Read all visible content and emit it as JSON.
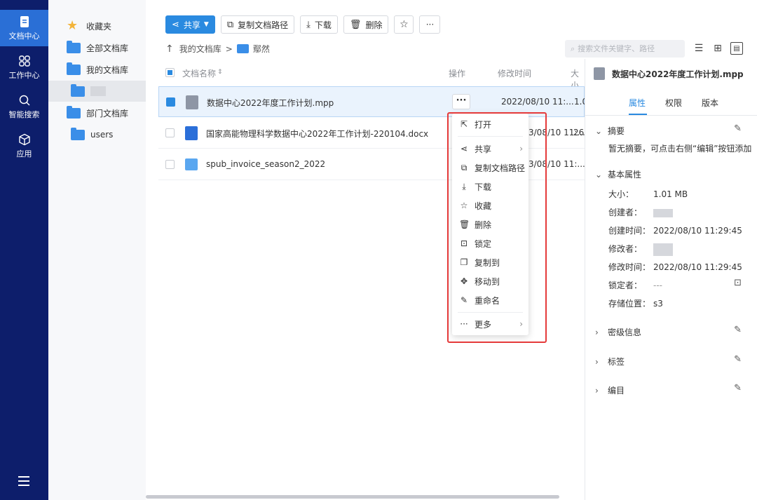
{
  "nav": {
    "items": [
      {
        "label": "文档中心",
        "icon": "document-icon",
        "active": true
      },
      {
        "label": "工作中心",
        "icon": "grid-icon",
        "active": false
      },
      {
        "label": "智能搜索",
        "icon": "search-icon",
        "active": false
      },
      {
        "label": "应用",
        "icon": "cube-icon",
        "active": false
      }
    ],
    "menu_icon": "hamburger-icon"
  },
  "libraries": [
    {
      "label": "收藏夹",
      "icon": "star-icon"
    },
    {
      "label": "全部文档库",
      "icon": "folder-icon"
    },
    {
      "label": "我的文档库",
      "icon": "user-folder-icon"
    },
    {
      "label": "",
      "icon": "shared-folder-icon",
      "selected": true
    },
    {
      "label": "部门文档库",
      "icon": "dept-folder-icon"
    },
    {
      "label": "users",
      "icon": "user-folder-icon"
    }
  ],
  "toolbar": {
    "share": "共享",
    "copy_path": "复制文档路径",
    "download": "下载",
    "delete": "删除",
    "more": "···"
  },
  "breadcrumb": {
    "root": "我的文档库",
    "current": "鄢然"
  },
  "search": {
    "placeholder": "搜索文件关键字、路径"
  },
  "table": {
    "headers": {
      "name": "文档名称",
      "ops": "操作",
      "modified": "修改时间",
      "size": "大小"
    },
    "rows": [
      {
        "name": "数据中心2022年度工作计划.mpp",
        "modified": "2022/08/10 11:...",
        "size": "1.0",
        "type": "mpp",
        "selected": true
      },
      {
        "name": "国家高能物理科学数据中心2022年工作计划-220104.docx",
        "modified": "3/08/10 11:...",
        "size": "26.",
        "type": "docx",
        "selected": false
      },
      {
        "name": "spub_invoice_season2_2022",
        "modified": "3/08/10 11:...",
        "size": "",
        "type": "folder",
        "selected": false
      }
    ]
  },
  "context_menu": {
    "items": [
      {
        "label": "打开",
        "icon": "open-external-icon"
      },
      {
        "label": "共享",
        "icon": "share-icon",
        "submenu": true
      },
      {
        "label": "复制文档路径",
        "icon": "copy-icon"
      },
      {
        "label": "下载",
        "icon": "download-icon"
      },
      {
        "label": "收藏",
        "icon": "star-icon"
      },
      {
        "label": "删除",
        "icon": "trash-icon"
      },
      {
        "label": "锁定",
        "icon": "lock-icon"
      },
      {
        "label": "复制到",
        "icon": "copy-to-icon"
      },
      {
        "label": "移动到",
        "icon": "move-icon"
      },
      {
        "label": "重命名",
        "icon": "rename-icon"
      },
      {
        "label": "更多",
        "icon": "more-icon",
        "submenu": true
      }
    ]
  },
  "details": {
    "title": "数据中心2022年度工作计划.mpp",
    "tabs": [
      "属性",
      "权限",
      "版本"
    ],
    "active_tab": "属性",
    "summary": {
      "label": "摘要",
      "text": "暂无摘要，可点击右侧“编辑”按钮添加"
    },
    "basic": {
      "label": "基本属性",
      "size_k": "大小：",
      "size_v": "1.01 MB",
      "creator_k": "创建者：",
      "ctime_k": "创建时间：",
      "ctime_v": "2022/08/10 11:29:45",
      "modifier_k": "修改者：",
      "mtime_k": "修改时间：",
      "mtime_v": "2022/08/10 11:29:45",
      "locker_k": "锁定者：",
      "locker_v": "---",
      "storage_k": "存储位置：",
      "storage_v": "s3"
    },
    "sections": [
      "密级信息",
      "标签",
      "编目"
    ]
  },
  "colors": {
    "nav_bg": "#0d1e6b",
    "accent": "#2a8ae0",
    "highlight_border": "#e53a3a"
  }
}
